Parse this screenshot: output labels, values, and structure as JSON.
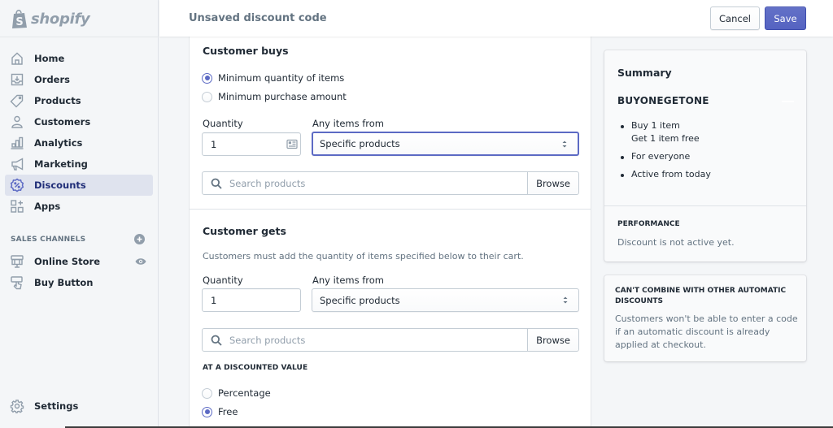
{
  "app": {
    "brand": "shopify",
    "accent_color": "#5c6ac4",
    "active_nav_color": "#202e78"
  },
  "sidebar": {
    "logo_icon": "shopify-bag-icon",
    "items": [
      {
        "label": "Home",
        "icon": "home-icon"
      },
      {
        "label": "Orders",
        "icon": "orders-inbox-icon"
      },
      {
        "label": "Products",
        "icon": "tag-icon"
      },
      {
        "label": "Customers",
        "icon": "person-icon"
      },
      {
        "label": "Analytics",
        "icon": "bar-chart-icon"
      },
      {
        "label": "Marketing",
        "icon": "megaphone-icon"
      },
      {
        "label": "Discounts",
        "icon": "discount-badge-icon",
        "active": true
      },
      {
        "label": "Apps",
        "icon": "apps-grid-icon"
      }
    ],
    "sales_channels": {
      "title": "SALES CHANNELS",
      "add_icon": "plus-circle-icon",
      "items": [
        {
          "label": "Online Store",
          "icon": "storefront-icon",
          "trail_icon": "eye-icon"
        },
        {
          "label": "Buy Button",
          "icon": "buy-button-icon"
        }
      ]
    },
    "settings": {
      "label": "Settings",
      "icon": "gear-icon"
    }
  },
  "topbar": {
    "title": "Unsaved discount code",
    "cancel_label": "Cancel",
    "save_label": "Save"
  },
  "customer_buys": {
    "title": "Customer buys",
    "options": [
      {
        "label": "Minimum quantity of items",
        "checked": true
      },
      {
        "label": "Minimum purchase amount",
        "checked": false
      }
    ],
    "quantity_label": "Quantity",
    "quantity_value": "1",
    "items_from_label": "Any items from",
    "items_from_value": "Specific products",
    "search_placeholder": "Search products",
    "browse_label": "Browse"
  },
  "customer_gets": {
    "title": "Customer gets",
    "help_text": "Customers must add the quantity of items specified below to their cart.",
    "quantity_label": "Quantity",
    "quantity_value": "1",
    "items_from_label": "Any items from",
    "items_from_value": "Specific products",
    "search_placeholder": "Search products",
    "browse_label": "Browse",
    "discounted_value_label": "AT A DISCOUNTED VALUE",
    "value_options": [
      {
        "label": "Percentage",
        "checked": false
      },
      {
        "label": "Free",
        "checked": true
      }
    ]
  },
  "summary": {
    "title": "Summary",
    "code": "BUYONEGETONE",
    "bullets": [
      {
        "lines": [
          "Buy 1 item",
          "Get 1 item free"
        ]
      },
      {
        "lines": [
          "For everyone"
        ]
      },
      {
        "lines": [
          "Active from today"
        ]
      }
    ],
    "performance_title": "PERFORMANCE",
    "performance_text": "Discount is not active yet."
  },
  "combine": {
    "title": "CAN'T COMBINE WITH OTHER AUTOMATIC DISCOUNTS",
    "text": "Customers won't be able to enter a code if an automatic discount is already applied at checkout."
  }
}
